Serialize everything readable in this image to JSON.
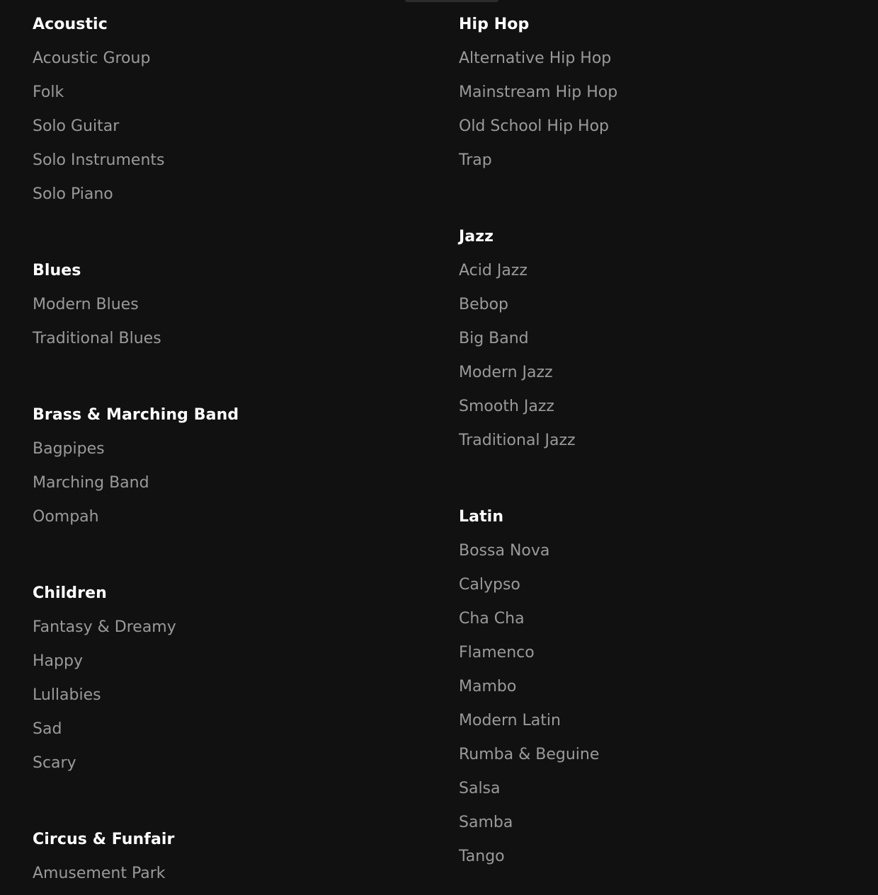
{
  "genres": {
    "acoustic": {
      "title": "Acoustic",
      "items": [
        "Acoustic Group",
        "Folk",
        "Solo Guitar",
        "Solo Instruments",
        "Solo Piano"
      ]
    },
    "blues": {
      "title": "Blues",
      "items": [
        "Modern Blues",
        "Traditional Blues"
      ]
    },
    "brass": {
      "title": "Brass & Marching Band",
      "items": [
        "Bagpipes",
        "Marching Band",
        "Oompah"
      ]
    },
    "children": {
      "title": "Children",
      "items": [
        "Fantasy & Dreamy",
        "Happy",
        "Lullabies",
        "Sad",
        "Scary"
      ]
    },
    "circus": {
      "title": "Circus & Funfair",
      "items": [
        "Amusement Park"
      ]
    },
    "hiphop": {
      "title": "Hip Hop",
      "items": [
        "Alternative Hip Hop",
        "Mainstream Hip Hop",
        "Old School Hip Hop",
        "Trap"
      ]
    },
    "jazz": {
      "title": "Jazz",
      "items": [
        "Acid Jazz",
        "Bebop",
        "Big Band",
        "Modern Jazz",
        "Smooth Jazz",
        "Traditional Jazz"
      ]
    },
    "latin": {
      "title": "Latin",
      "items": [
        "Bossa Nova",
        "Calypso",
        "Cha Cha",
        "Flamenco",
        "Mambo",
        "Modern Latin",
        "Rumba & Beguine",
        "Salsa",
        "Samba",
        "Tango"
      ]
    }
  }
}
